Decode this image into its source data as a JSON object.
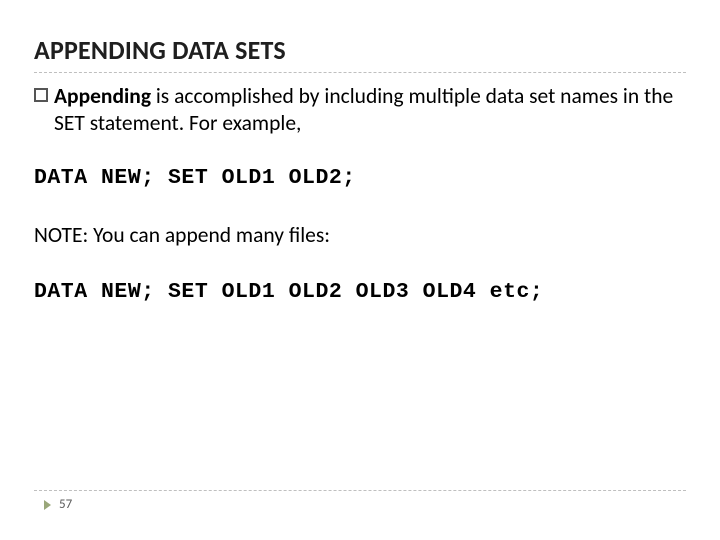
{
  "title": "APPENDING DATA SETS",
  "bullet": {
    "lead": "Appending",
    "rest": " is accomplished by including multiple data set names in the SET statement. For example,"
  },
  "code1": "DATA NEW; SET OLD1 OLD2;",
  "note": "NOTE: You can append many files:",
  "code2": "DATA NEW; SET OLD1 OLD2 OLD3 OLD4 etc;",
  "page_number": "57"
}
